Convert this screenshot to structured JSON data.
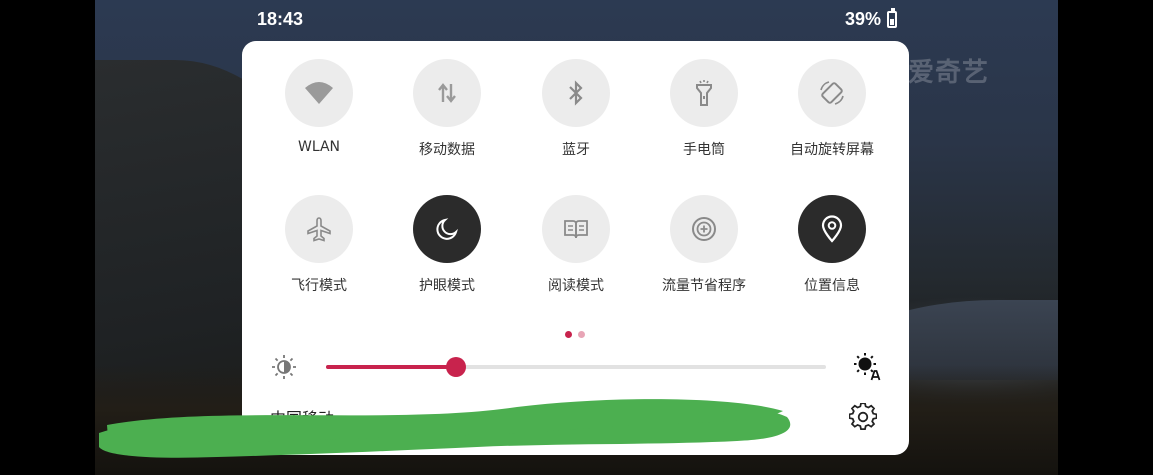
{
  "status_bar": {
    "time": "18:43",
    "battery": "39%"
  },
  "watermark": "爱奇艺",
  "tiles": [
    {
      "label": "WLAN",
      "icon": "wifi-icon",
      "active": false
    },
    {
      "label": "移动数据",
      "icon": "mobile-data-icon",
      "active": false
    },
    {
      "label": "蓝牙",
      "icon": "bluetooth-icon",
      "active": false
    },
    {
      "label": "手电筒",
      "icon": "flashlight-icon",
      "active": false
    },
    {
      "label": "自动旋转屏幕",
      "icon": "auto-rotate-icon",
      "active": false
    },
    {
      "label": "飞行模式",
      "icon": "airplane-icon",
      "active": false
    },
    {
      "label": "护眼模式",
      "icon": "moon-icon",
      "active": true
    },
    {
      "label": "阅读模式",
      "icon": "book-icon",
      "active": false
    },
    {
      "label": "流量节省程序",
      "icon": "data-saver-icon",
      "active": false
    },
    {
      "label": "位置信息",
      "icon": "location-pin-icon",
      "active": true
    }
  ],
  "page_indicator": {
    "pages": 2,
    "current": 1
  },
  "brightness": {
    "level": 0.26
  },
  "footer": {
    "operator": "中国移动"
  },
  "colors": {
    "accent": "#c8234d",
    "active_tile": "#2b2b2b",
    "inactive_tile": "#ececec",
    "redaction": "#4caf50"
  }
}
